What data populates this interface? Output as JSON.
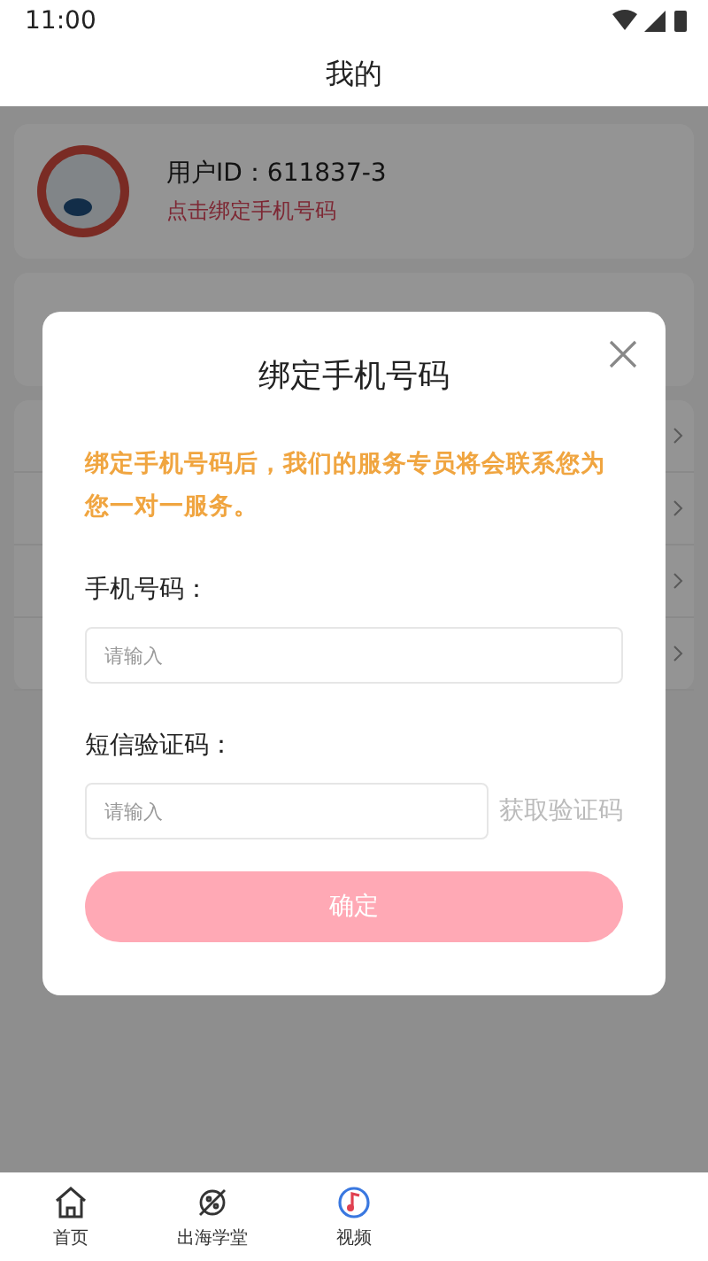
{
  "status_bar": {
    "time": "11:00"
  },
  "header": {
    "title": "我的"
  },
  "profile": {
    "user_id": "用户ID：611837-3",
    "bind_link": "点击绑定手机号码"
  },
  "dialog": {
    "title": "绑定手机号码",
    "notice": "绑定手机号码后，我们的服务专员将会联系您为您一对一服务。",
    "phone_label": "手机号码：",
    "phone_placeholder": "请输入",
    "code_label": "短信验证码：",
    "code_placeholder": "请输入",
    "code_button": "获取验证码",
    "confirm": "确定"
  },
  "bottom_nav": [
    {
      "label": "首页",
      "kind": "home"
    },
    {
      "label": "出海学堂",
      "kind": "planet"
    },
    {
      "label": "视频",
      "kind": "video"
    }
  ]
}
